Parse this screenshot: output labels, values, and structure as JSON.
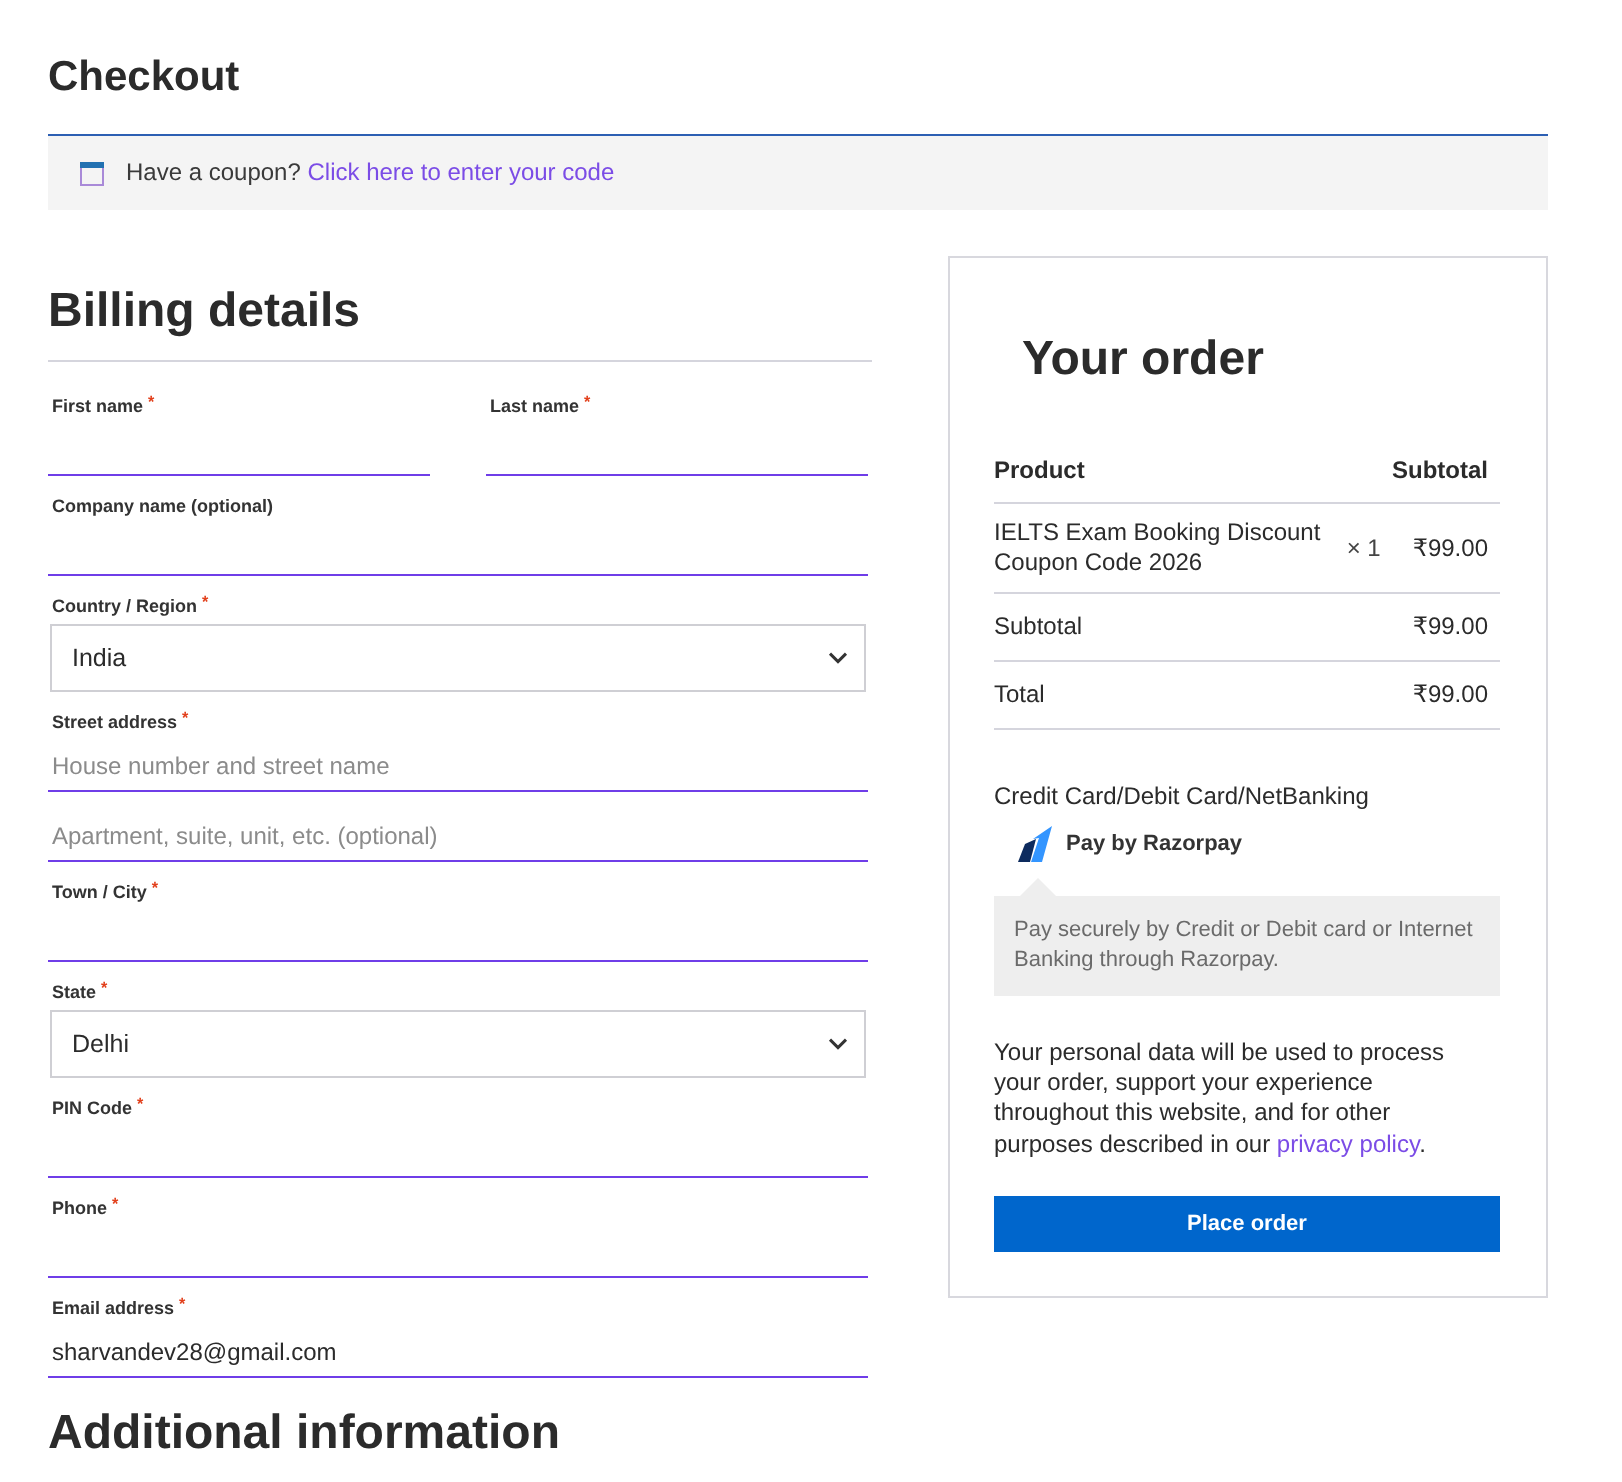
{
  "page": {
    "title": "Checkout"
  },
  "coupon_notice": {
    "text": "Have a coupon?",
    "link": "Click here to enter your code"
  },
  "billing": {
    "title": "Billing details",
    "name_fields": [
      {
        "kind": "text",
        "label": "First name $^{*}$"
      },
      {
        "kind": "text",
        "label": "Last name $^{*}$"
      }
    ],
    "fields": [
      {
        "kind": "text",
        "label": "Company name (optional)"
      },
      {
        "kind": "select",
        "label": "Country / Region $^{*}$",
        "value": "India"
      },
      {
        "kind": "text",
        "label": "Street address $^{*}$",
        "placeholder": "House number and street name"
      },
      {
        "kind": "text",
        "placeholder": "Apartment, suite, unit, etc. (optional)"
      },
      {
        "kind": "text",
        "label": "Town / City $^{*}$"
      },
      {
        "kind": "select",
        "label": "State $^{*}$",
        "value": "Delhi"
      },
      {
        "kind": "text",
        "label": "PIN Code $^{*}$"
      },
      {
        "kind": "text",
        "label": "Phone $^{*}$"
      },
      {
        "kind": "text",
        "label": "Email address $^{*}$",
        "value": "sharvandev28@gmail.com"
      }
    ]
  },
  "additional": {
    "title": "Additional information"
  },
  "order": {
    "title": "Your order",
    "columns": [
      "Product",
      "Subtotal"
    ],
    "items": [
      {
        "name": "IELTS Exam Booking Discount Coupon Code 2026",
        "quantity": "× 1",
        "price": "₹99.00"
      }
    ],
    "totals": [
      {
        "label": "Subtotal",
        "value": "₹99.00"
      },
      {
        "label": "Total",
        "value": "₹99.00"
      }
    ],
    "payment": {
      "method": "Credit Card/Debit Card/NetBanking",
      "provider": "Pay by Razorpay",
      "description": "Pay securely by Credit or Debit card or Internet Banking through Razorpay."
    },
    "privacy": {
      "text": "Your personal data will be used to process your order, support your experience throughout this website, and for other purposes described in our",
      "link": "privacy policy",
      "after": "."
    },
    "button": "Place order"
  }
}
